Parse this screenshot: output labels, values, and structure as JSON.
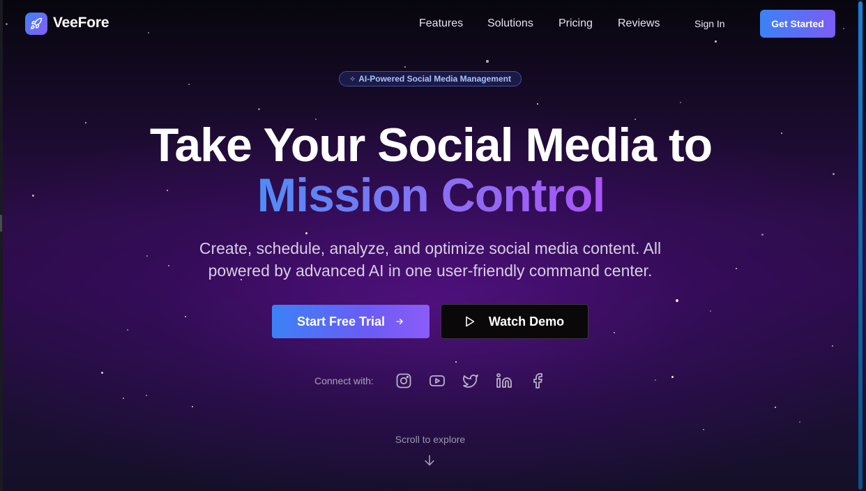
{
  "brand": {
    "name": "VeeFore",
    "logo_icon": "rocket-icon",
    "accent_from": "#3b82f6",
    "accent_to": "#8b5cf6"
  },
  "nav": {
    "links": [
      "Features",
      "Solutions",
      "Pricing",
      "Reviews"
    ],
    "sign_in": "Sign In",
    "get_started": "Get Started"
  },
  "hero": {
    "badge": "AI-Powered Social Media Management",
    "badge_icon": "sparkles-icon",
    "headline_line1": "Take Your Social Media to",
    "headline_line2": "Mission Control",
    "subtitle_line1": "Create, schedule, analyze, and optimize social media content. All",
    "subtitle_line2": "powered by advanced AI in one user-friendly command center.",
    "primary_cta": "Start Free Trial",
    "primary_cta_icon": "arrow-right-icon",
    "secondary_cta": "Watch Demo",
    "secondary_cta_icon": "play-icon"
  },
  "connect": {
    "label": "Connect with:",
    "networks": [
      "instagram-icon",
      "youtube-icon",
      "twitter-icon",
      "linkedin-icon",
      "facebook-icon"
    ]
  },
  "scroll_hint": {
    "label": "Scroll to explore",
    "icon": "arrow-down-icon"
  }
}
